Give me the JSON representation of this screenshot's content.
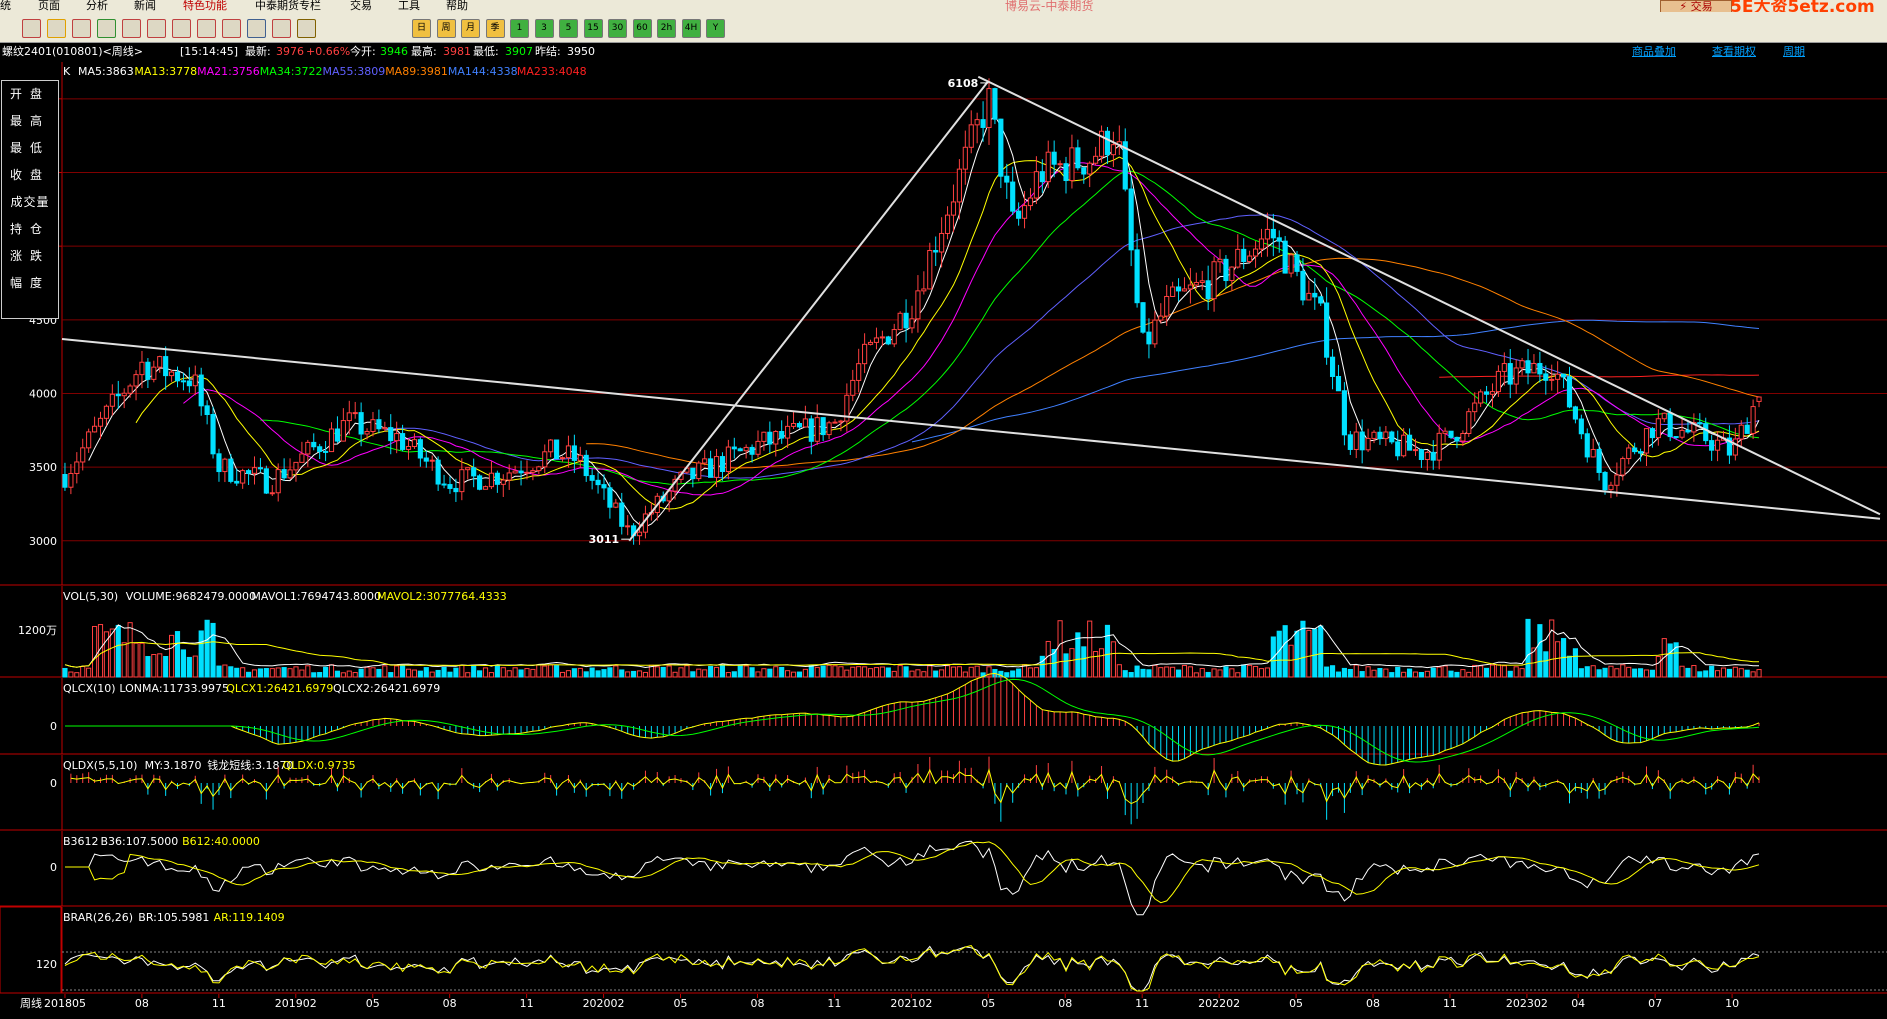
{
  "menu": {
    "items": [
      "统",
      "页面",
      "分析",
      "新闻",
      "特色功能",
      "中泰期货专栏",
      "交易",
      "工具",
      "帮助"
    ],
    "app_title": "博易云-中泰期货",
    "trade_button": "⚡ 交易",
    "watermark": "5E大资5etz.com"
  },
  "toolbar": {
    "periods": [
      "日",
      "周",
      "月",
      "季",
      "1",
      "3",
      "5",
      "15",
      "30",
      "60",
      "2h",
      "4H",
      "Y"
    ]
  },
  "info": {
    "instrument": "螺纹2401(010801)<周线>",
    "time": "[15:14:45]",
    "latest_label": "最新:",
    "latest": "3976",
    "change": "+0.66%",
    "open_label": "今开:",
    "open": "3946",
    "high_label": "最高:",
    "high": "3981",
    "low_label": "最低:",
    "low": "3907",
    "prev_label": "昨结:",
    "prev": "3950",
    "links": [
      "商品叠加",
      "查看期权",
      "周期"
    ]
  },
  "side_panel": [
    "开盘",
    "最高",
    "最低",
    "收盘",
    "成交量",
    "持仓",
    "涨跌",
    "幅度"
  ],
  "colors": {
    "up": "#ff4040",
    "down": "#00e0ff",
    "ma5": "#ffffff",
    "ma13": "#ffff00",
    "ma21": "#ff00ff",
    "ma34": "#00ff00",
    "ma55": "#6060ff",
    "ma89": "#ff8000",
    "ma144": "#4080ff",
    "ma233": "#ff2020",
    "grid": "#800000"
  },
  "chart_data": [
    {
      "type": "candlestick",
      "title": "K",
      "period": "周线",
      "ma_legend": [
        {
          "name": "MA5",
          "value": 3863,
          "color": "#ffffff"
        },
        {
          "name": "MA13",
          "value": 3778,
          "color": "#ffff00"
        },
        {
          "name": "MA21",
          "value": 3756,
          "color": "#ff00ff"
        },
        {
          "name": "MA34",
          "value": 3722,
          "color": "#00ff00"
        },
        {
          "name": "MA55",
          "value": 3809,
          "color": "#6060ff"
        },
        {
          "name": "MA89",
          "value": 3981,
          "color": "#ff8000"
        },
        {
          "name": "MA144",
          "value": 4338,
          "color": "#4080ff"
        },
        {
          "name": "MA233",
          "value": 4048,
          "color": "#ff2020"
        }
      ],
      "y_ticks": [
        3000,
        3500,
        4000,
        4500
      ],
      "ylim": [
        2700,
        6250
      ],
      "annotations": [
        {
          "text": "6108",
          "x": "2021-05",
          "y": 6108
        },
        {
          "text": "3011",
          "x": "2020-03",
          "y": 3011
        }
      ],
      "x_labels": [
        "201805",
        "08",
        "11",
        "201902",
        "05",
        "08",
        "11",
        "202002",
        "05",
        "08",
        "11",
        "202102",
        "05",
        "08",
        "11",
        "202202",
        "05",
        "08",
        "11",
        "202302",
        "04",
        "07",
        "10"
      ],
      "anchor_closes": [
        [
          "2018-05",
          3450
        ],
        [
          "2018-08",
          4200
        ],
        [
          "2018-10",
          4100
        ],
        [
          "2018-11",
          3500
        ],
        [
          "2019-01",
          3400
        ],
        [
          "2019-04",
          3800
        ],
        [
          "2019-06",
          3700
        ],
        [
          "2019-08",
          3400
        ],
        [
          "2019-10",
          3450
        ],
        [
          "2019-12",
          3600
        ],
        [
          "2020-01",
          3550
        ],
        [
          "2020-03",
          3050
        ],
        [
          "2020-05",
          3400
        ],
        [
          "2020-08",
          3650
        ],
        [
          "2020-11",
          3800
        ],
        [
          "2020-12",
          4200
        ],
        [
          "2021-02",
          4600
        ],
        [
          "2021-05",
          6000
        ],
        [
          "2021-06",
          5100
        ],
        [
          "2021-07",
          5500
        ],
        [
          "2021-09",
          5600
        ],
        [
          "2021-10",
          5800
        ],
        [
          "2021-11",
          4300
        ],
        [
          "2021-12",
          4600
        ],
        [
          "2022-02",
          4800
        ],
        [
          "2022-04",
          5100
        ],
        [
          "2022-06",
          4500
        ],
        [
          "2022-07",
          3700
        ],
        [
          "2022-10",
          3600
        ],
        [
          "2022-11",
          3700
        ],
        [
          "2023-01",
          4100
        ],
        [
          "2023-03",
          4200
        ],
        [
          "2023-05",
          3400
        ],
        [
          "2023-07",
          3800
        ],
        [
          "2023-09",
          3700
        ],
        [
          "2023-10",
          3600
        ],
        [
          "2023-11",
          3976
        ]
      ]
    },
    {
      "type": "bar",
      "title": "VOL(5,30)",
      "legend": [
        {
          "name": "VOLUME",
          "value": "9682479.0000",
          "color": "#ffffff"
        },
        {
          "name": "MAVOL1",
          "value": "7694743.8000",
          "color": "#ffffff"
        },
        {
          "name": "MAVOL2",
          "value": "3077764.4333",
          "color": "#ffff00"
        }
      ],
      "y_tick": "1200万"
    },
    {
      "type": "bar",
      "title": "QLCX(10)",
      "legend": [
        {
          "name": "LONMA",
          "value": "11733.9975",
          "color": "#ffffff"
        },
        {
          "name": "QLCX1",
          "value": "26421.6979",
          "color": "#ffff00"
        },
        {
          "name": "QLCX2",
          "value": "26421.6979",
          "color": "#ffffff"
        }
      ],
      "y_tick": "0"
    },
    {
      "type": "bar",
      "title": "QLDX(5,5,10)",
      "legend": [
        {
          "name": "MY",
          "value": "3.1870",
          "color": "#ffffff"
        },
        {
          "name": "钱龙短线",
          "value": "3.1870",
          "color": "#ffffff"
        },
        {
          "name": "QLDX",
          "value": "0.9735",
          "color": "#ffff00"
        }
      ],
      "y_tick": "0"
    },
    {
      "type": "line",
      "title": "B3612",
      "legend": [
        {
          "name": "B36",
          "value": "107.5000",
          "color": "#ffffff"
        },
        {
          "name": "B612",
          "value": "40.0000",
          "color": "#ffff00"
        }
      ],
      "y_tick": "0"
    },
    {
      "type": "line",
      "title": "BRAR(26,26)",
      "legend": [
        {
          "name": "BR",
          "value": "105.5981",
          "color": "#ffffff"
        },
        {
          "name": "AR",
          "value": "119.1409",
          "color": "#ffff00"
        }
      ],
      "y_tick": "120"
    }
  ],
  "axis_period_label": "周线"
}
